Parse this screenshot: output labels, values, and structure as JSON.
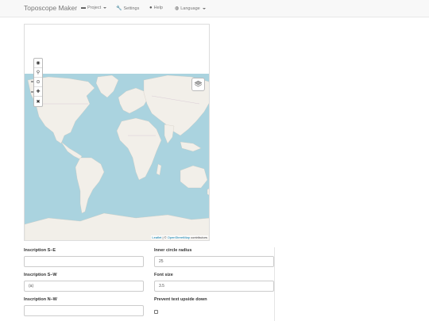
{
  "navbar": {
    "brand": "Toposcope Maker",
    "items": [
      {
        "label": "Project",
        "icon": "file-icon",
        "dropdown": true
      },
      {
        "label": "Settings",
        "icon": "wrench-icon",
        "dropdown": false
      },
      {
        "label": "Help",
        "icon": "question-circle-icon",
        "dropdown": false
      },
      {
        "label": "Language",
        "icon": "globe-icon",
        "dropdown": true
      }
    ]
  },
  "map": {
    "controls": [
      "eye-icon",
      "pin-icon",
      "target-icon",
      "plus-icon",
      "close-icon"
    ],
    "attribution": {
      "leaflet": "Leaflet",
      "separator": " | © ",
      "osm": "OpenStreetMap",
      "suffix": " contributors"
    },
    "ocean_color": "#aad3df",
    "land_color": "#f2efe9"
  },
  "form": {
    "inscription_se": {
      "label": "Inscription S–E",
      "value": ""
    },
    "inscription_sw": {
      "label": "Inscription S–W",
      "value": "(a)"
    },
    "inscription_nw": {
      "label": "Inscription N–W",
      "value": ""
    },
    "inner_circle_radius": {
      "label": "Inner circle radius",
      "value": "25"
    },
    "font_size": {
      "label": "Font size",
      "value": "3.5"
    },
    "prevent_upside_down": {
      "label": "Prevent text upside down",
      "checked": false
    }
  }
}
